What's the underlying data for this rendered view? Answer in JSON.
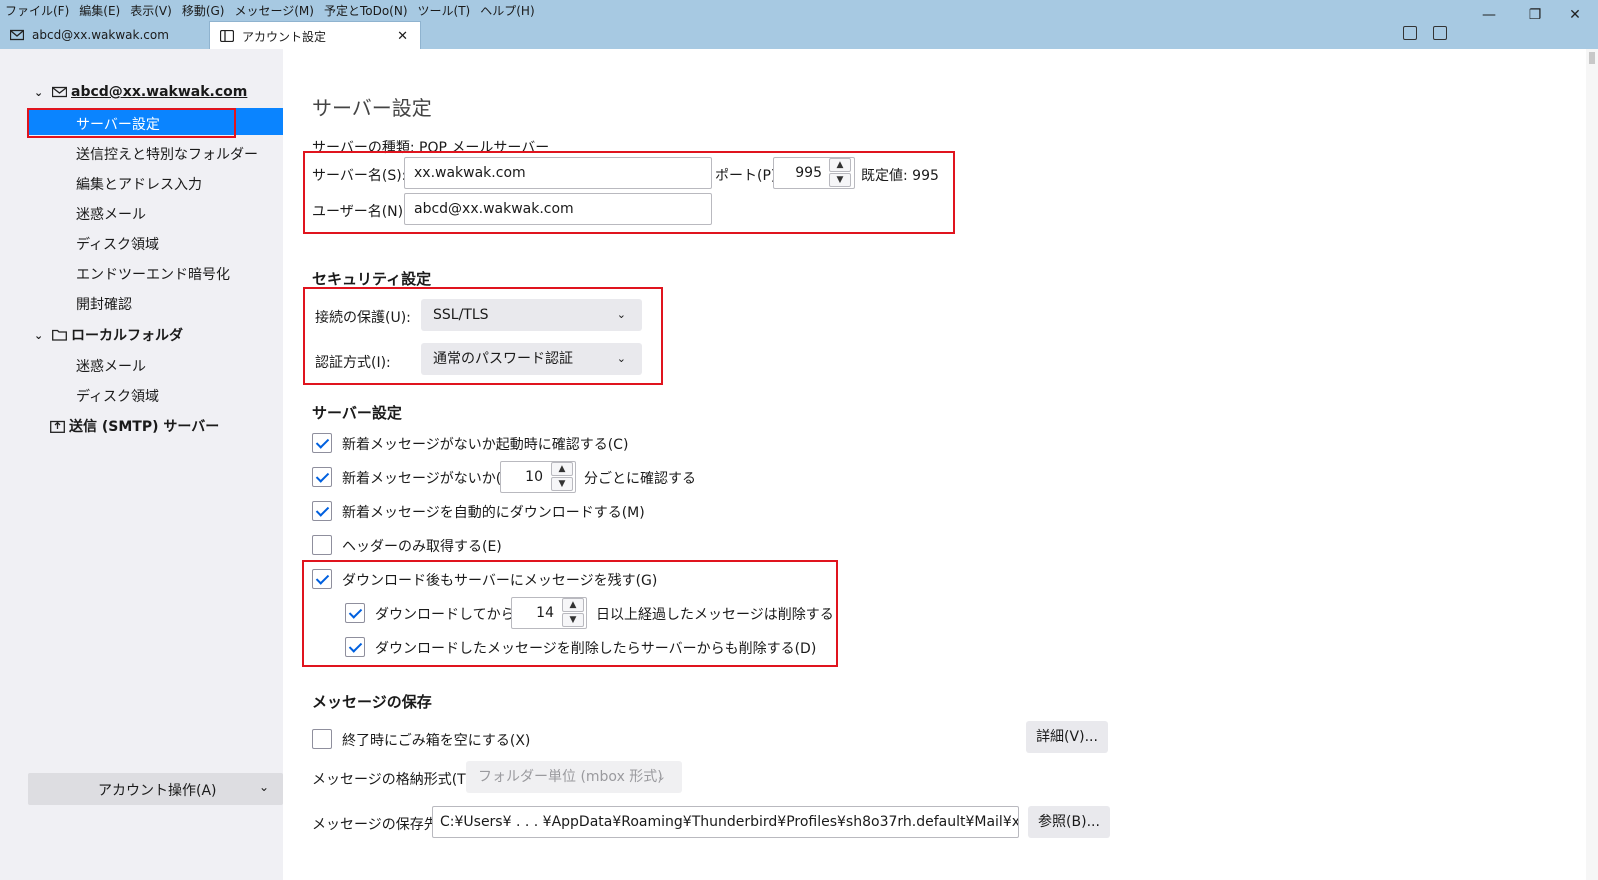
{
  "menu": [
    "ファイル(F)",
    "編集(E)",
    "表示(V)",
    "移動(G)",
    "メッセージ(M)",
    "予定とToDo(N)",
    "ツール(T)",
    "ヘルプ(H)"
  ],
  "window_controls": {
    "minimize": "—",
    "restore": "❐",
    "close": "✕"
  },
  "tabs": [
    {
      "label": "abcd@xx.wakwak.com",
      "icon": "mail-icon"
    },
    {
      "label": "アカウント設定",
      "icon": "settings-page-icon",
      "close": "✕"
    }
  ],
  "sidebar": {
    "account": "abcd@xx.wakwak.com",
    "account_items": [
      "サーバー設定",
      "送信控えと特別なフォルダー",
      "編集とアドレス入力",
      "迷惑メール",
      "ディスク領域",
      "エンドツーエンド暗号化",
      "開封確認"
    ],
    "local_folder": "ローカルフォルダ",
    "local_items": [
      "迷惑メール",
      "ディスク領域"
    ],
    "smtp": "送信 (SMTP) サーバー",
    "account_actions": "アカウント操作(A)"
  },
  "page": {
    "title": "サーバー設定",
    "server_type": "サーバーの種類: POP メールサーバー",
    "server_name_label": "サーバー名(S):",
    "server_name": "xx.wakwak.com",
    "port_label": "ポート(P):",
    "port": "995",
    "default_port": "既定値: 995",
    "user_name_label": "ユーザー名(N):",
    "user_name": "abcd@xx.wakwak.com",
    "security_heading": "セキュリティ設定",
    "connection_label": "接続の保護(U):",
    "connection_value": "SSL/TLS",
    "auth_label": "認証方式(I):",
    "auth_value": "通常のパスワード認証",
    "server_heading": "サーバー設定",
    "check_startup": "新着メッセージがないか起動時に確認する(C)",
    "check_every_prefix": "新着メッセージがないか(Y)",
    "check_every_value": "10",
    "check_every_suffix": "分ごとに確認する",
    "auto_download": "新着メッセージを自動的にダウンロードする(M)",
    "headers_only": "ヘッダーのみ取得する(E)",
    "leave_on_server": "ダウンロード後もサーバーにメッセージを残す(G)",
    "delete_after_prefix": "ダウンロードしてから(O)",
    "delete_after_value": "14",
    "delete_after_suffix": "日以上経過したメッセージは削除する",
    "delete_when_deleted": "ダウンロードしたメッセージを削除したらサーバーからも削除する(D)",
    "storage_heading": "メッセージの保存",
    "empty_trash": "終了時にごみ箱を空にする(X)",
    "advanced_button": "詳細(V)...",
    "store_format_label": "メッセージの格納形式(T):",
    "store_format_value": "フォルダー単位 (mbox 形式)",
    "local_dir_label": "メッセージの保存先:",
    "local_dir_value": "C:¥Users¥ . . . ¥AppData¥Roaming¥Thunderbird¥Profiles¥sh8o37rh.default¥Mail¥x",
    "browse_button": "参照(B)..."
  },
  "checkboxes": {
    "check_startup": true,
    "check_every": true,
    "auto_download": true,
    "headers_only": false,
    "leave_on_server": true,
    "delete_after": true,
    "delete_when_deleted": true,
    "empty_trash": false
  },
  "colors": {
    "accent": "#0a84ff",
    "highlight_box": "#e0141e",
    "titlebar": "#a7c9e2"
  }
}
